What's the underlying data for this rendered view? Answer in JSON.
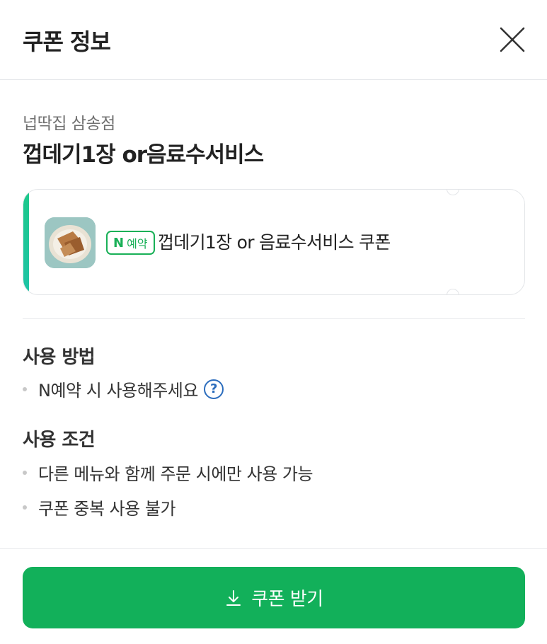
{
  "header": {
    "title": "쿠폰 정보"
  },
  "store": {
    "name": "넙딱집 삼송점"
  },
  "coupon": {
    "name": "껍데기1장 or음료수서비스",
    "badge_n": "N",
    "badge_label": "예약",
    "ticket_title": "껍데기1장 or 음료수서비스 쿠폰",
    "accent_color": "#1cc88a"
  },
  "usage": {
    "title": "사용 방법",
    "items": [
      "N예약 시 사용해주세요"
    ],
    "help_label": "?"
  },
  "conditions": {
    "title": "사용 조건",
    "items": [
      "다른 메뉴와 함께 주문 시에만 사용 가능",
      "쿠폰 중복 사용 불가"
    ]
  },
  "cta": {
    "label": "쿠폰 받기",
    "icon": "download-icon",
    "color": "#12b05a"
  }
}
